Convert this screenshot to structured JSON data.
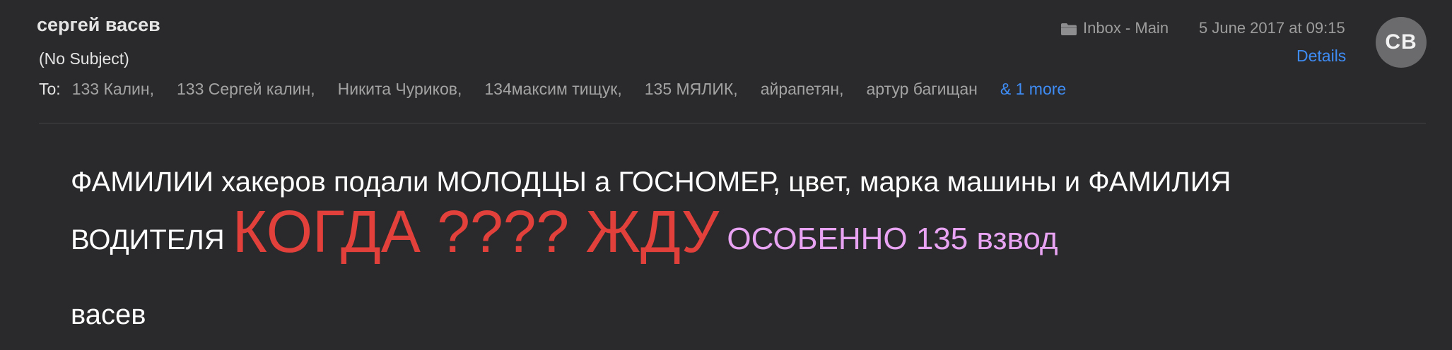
{
  "header": {
    "sender": "сергей васев",
    "subject": "(No Subject)",
    "to_label": "To:",
    "recipients": [
      "133 Калин,",
      "133 Сергей калин,",
      "Никита Чуриков,",
      "134максим тищук,",
      "135 МЯЛИК,",
      "айрапетян,",
      "артур багищан"
    ],
    "more_link": "& 1 more",
    "mailbox": "Inbox - Main",
    "mailbox_icon": "folder-icon",
    "date": "5 June 2017 at 09:15",
    "details_label": "Details",
    "avatar_initials": "СВ"
  },
  "body": {
    "line1": "ФАМИЛИИ хакеров подали МОЛОДЦЫ а ГОСНОМЕР, цвет, марка машины и ФАМИЛИЯ",
    "line2_start": "ВОДИТЕЛЯ",
    "line2_red": "КОГДА ???? ЖДУ",
    "line2_pink": "ОСОБЕННО 135 взвод",
    "signature": "васев"
  },
  "colors": {
    "background": "#2a2a2c",
    "accent_link": "#3e8cf4",
    "emphasis_red": "#e2403a",
    "emphasis_pink": "#e8a4f3",
    "body_text": "#ffffff",
    "muted_text": "#9d9d9d"
  }
}
